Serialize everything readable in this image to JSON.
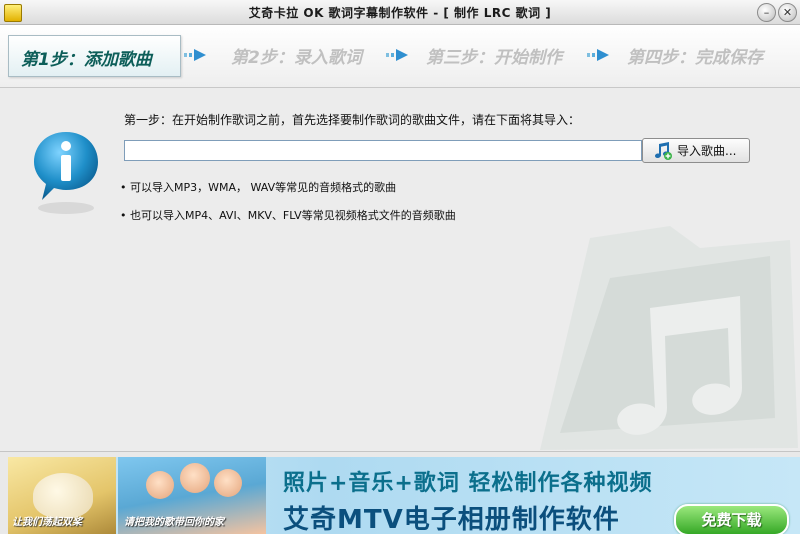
{
  "window": {
    "title": "艾奇卡拉 OK 歌词字幕制作软件 - [ 制作 LRC 歌词 ]",
    "minimize_glyph": "–",
    "close_glyph": "✕"
  },
  "steps": [
    {
      "label": "第1步：添加歌曲",
      "active": true
    },
    {
      "label": "第2步：录入歌词",
      "active": false
    },
    {
      "label": "第三步：开始制作",
      "active": false
    },
    {
      "label": "第四步：完成保存",
      "active": false
    }
  ],
  "main": {
    "description": "第一步：在开始制作歌词之前，首先选择要制作歌词的歌曲文件，请在下面将其导入：",
    "file_input_value": "",
    "import_button_label": "导入歌曲...",
    "bullets": [
      "• 可以导入MP3，WMA， WAV等常见的音频格式的歌曲",
      "• 也可以导入MP4、AVI、MKV、FLV等常见视频格式文件的音频歌曲"
    ]
  },
  "banner": {
    "photo1_caption": "让我们荡起双桨",
    "photo2_caption": "请把我的歌带回你的家",
    "headline1": "照片+音乐+歌词 轻松制作各种视频",
    "headline2": "艾奇MTV电子相册制作软件",
    "download_label": "免费下载"
  },
  "colors": {
    "active_step": "#0d5e59",
    "inactive_step": "#c0c0c0",
    "info_icon": "#1f8fc9",
    "banner_text": "#0b4f7d",
    "download_button": "#35a826"
  },
  "icons": [
    "app-icon",
    "info-icon",
    "music-note-add-icon",
    "step-arrow-icon",
    "watermark-music-folder-icon"
  ]
}
